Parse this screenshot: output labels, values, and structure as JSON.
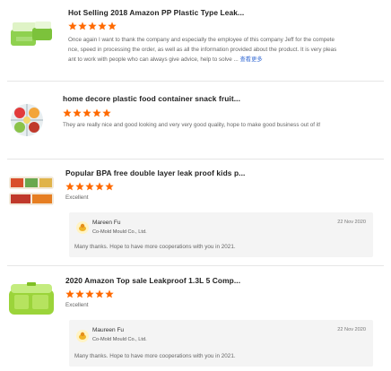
{
  "reviews": [
    {
      "title": "Hot Selling 2018 Amazon PP Plastic Type Leak...",
      "rating": 5,
      "image": "green-lunch-box-photo",
      "text_lines": [
        "Once again I want to thank the company and especially the employee of this company Jeff for the compete",
        "nce, speed in processing the order, as well as all the information provided about the product. It is very pleas",
        "ant to work with people who can always give advice, help to solve ..."
      ],
      "more_label": "查看更多"
    },
    {
      "title": "home decore plastic food container snack fruit...",
      "rating": 5,
      "image": "divided-fruit-tray-photo",
      "text_lines": [
        "They are really nice and good looking and very very good quality, hope to make good business out of it!"
      ]
    },
    {
      "title": "Popular BPA free double layer leak proof kids p...",
      "rating": 5,
      "image": "double-layer-bento-photo",
      "text_lines": [
        "Excellent"
      ],
      "reply": {
        "name": "Mareen Fu",
        "company": "Co-Mold Mould Co., Ltd.",
        "date": "22 Nov 2020",
        "text": "Many thanks. Hope to have more cooperations with you in 2021."
      }
    },
    {
      "title": "2020 Amazon Top sale Leakproof 1.3L 5 Comp...",
      "rating": 5,
      "image": "lime-lunch-box-photo",
      "text_lines": [
        "Excellent"
      ],
      "reply": {
        "name": "Maureen Fu",
        "company": "Co-Mold Mould Co., Ltd.",
        "date": "22 Nov 2020",
        "text": "Many thanks. Hope to have more cooperations with you in 2021."
      }
    }
  ],
  "colors": {
    "star": "#ff6a00",
    "link": "#3b6fd6"
  }
}
